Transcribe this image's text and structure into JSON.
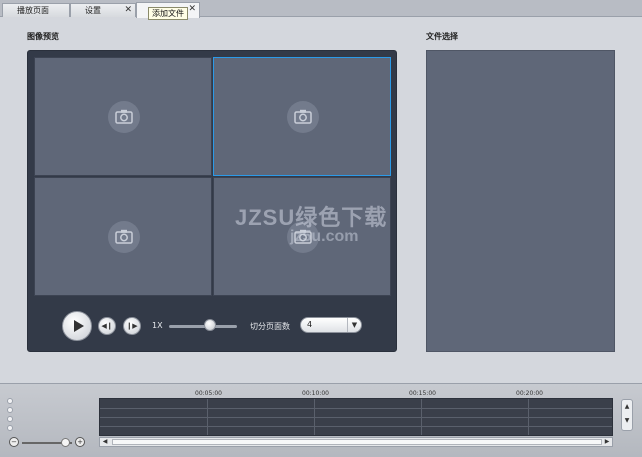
{
  "tabs": [
    {
      "label": "播放页面"
    },
    {
      "label": "设置",
      "close": "✕"
    },
    {
      "label": "",
      "close": "✕"
    }
  ],
  "tooltip": "添加文件",
  "preview": {
    "title": "图像预览",
    "selected_cell": 1,
    "controls": {
      "speed_label": "1X",
      "speed_slider_fraction": 0.6,
      "split_label": "切分页面数",
      "split_value": "4"
    }
  },
  "file_panel": {
    "title": "文件选择"
  },
  "watermark": {
    "main": "JZSU绿色下载",
    "sub": "jz5u.com"
  },
  "timeline": {
    "time_labels": [
      "00:05:00",
      "00:10:00",
      "00:15:00",
      "00:20:00"
    ],
    "zoom_fraction": 0.85
  },
  "colors": {
    "accent": "#2b9ae8",
    "panel": "#5f6778",
    "frame": "#333a48"
  },
  "icons": [
    "camera-off-icon",
    "play-icon",
    "step-back-icon",
    "step-forward-icon",
    "zoom-out-icon",
    "zoom-in-icon",
    "close-icon",
    "dropdown-arrow-icon"
  ]
}
